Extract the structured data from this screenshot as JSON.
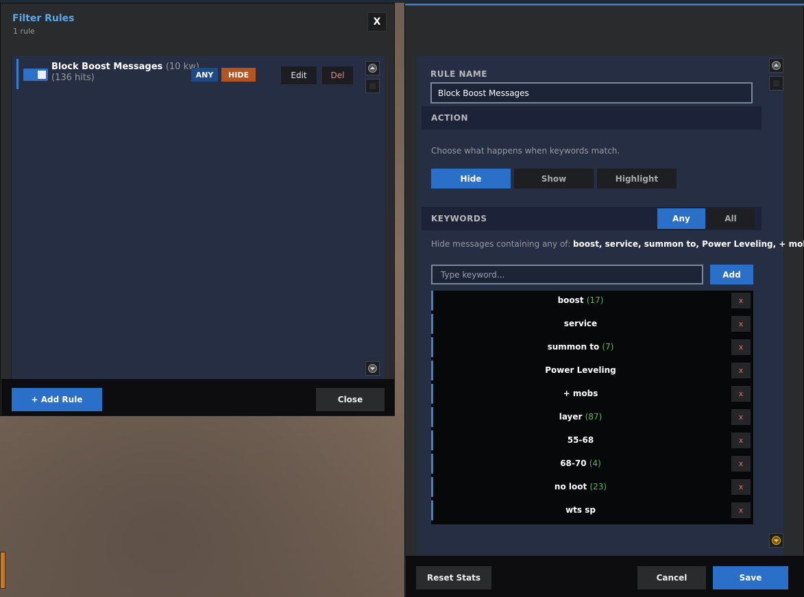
{
  "rules_panel": {
    "title": "Filter Rules",
    "subtitle": "1 rule",
    "close_label": "X",
    "rules": [
      {
        "name": "Block Boost Messages",
        "keyword_count": "(10 kw)",
        "hits": "(136 hits)",
        "enabled": true,
        "match_mode": "ANY",
        "action": "HIDE",
        "edit_label": "Edit",
        "delete_label": "Del"
      }
    ],
    "add_rule_label": "+ Add Rule",
    "close_button_label": "Close"
  },
  "editor_panel": {
    "rule_name_label": "RULE NAME",
    "rule_name_value": "Block Boost Messages",
    "action_section": {
      "label": "ACTION",
      "description": "Choose what happens when keywords match.",
      "options": [
        "Hide",
        "Show",
        "Highlight"
      ],
      "selected": "Hide"
    },
    "keywords_section": {
      "label": "KEYWORDS",
      "modes": [
        "Any",
        "All"
      ],
      "selected_mode": "Any",
      "summary_prefix": "Hide messages containing any of:",
      "summary_keywords": "boost, service, summon to, Power Leveling, + mobs...",
      "input_placeholder": "Type keyword...",
      "add_label": "Add",
      "remove_label": "x",
      "keywords": [
        {
          "text": "boost",
          "count": "(17)"
        },
        {
          "text": "service",
          "count": ""
        },
        {
          "text": "summon to",
          "count": "(7)"
        },
        {
          "text": "Power Leveling",
          "count": ""
        },
        {
          "text": "+ mobs",
          "count": ""
        },
        {
          "text": "layer",
          "count": "(87)"
        },
        {
          "text": "55-68",
          "count": ""
        },
        {
          "text": "68-70",
          "count": "(4)"
        },
        {
          "text": "no loot",
          "count": "(23)"
        },
        {
          "text": "wts sp",
          "count": ""
        }
      ]
    },
    "reset_stats_label": "Reset Stats",
    "cancel_label": "Cancel",
    "save_label": "Save"
  },
  "colors": {
    "accent": "#2a6fc8",
    "title_blue": "#58a8ec",
    "hide_badge": "#b4541e",
    "count_green": "#58b858",
    "remove_red": "#e07070"
  }
}
